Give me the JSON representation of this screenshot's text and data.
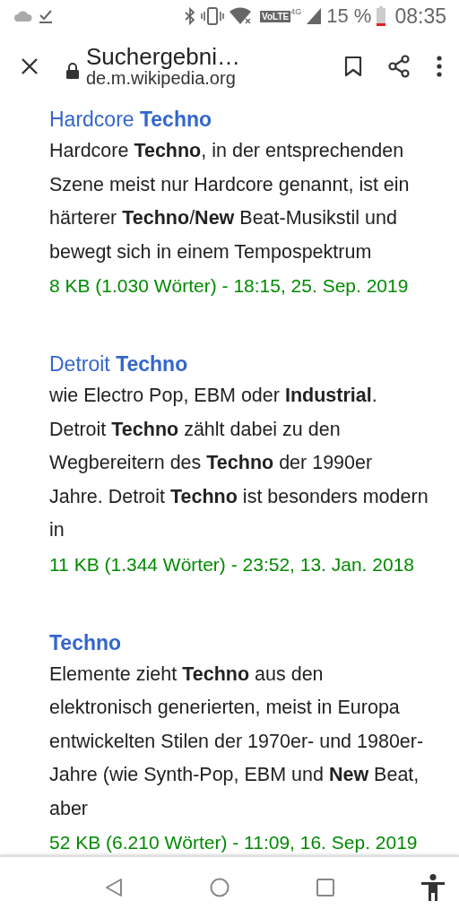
{
  "status_bar": {
    "volte": "VoLTE",
    "network": "4G",
    "battery": "15 %",
    "time": "08:35"
  },
  "toolbar": {
    "title": "Suchergebni…",
    "url": "de.m.wikipedia.org"
  },
  "results": [
    {
      "title": "Hardcore **Techno**",
      "snippet": "Hardcore **Techno**, in der entsprechenden Szene meist nur Hardcore genannt, ist ein härterer **Techno**/**New** Beat-Musikstil und bewegt sich in einem Tempospektrum",
      "meta": "8 KB (1.030 Wörter) - 18:15, 25. Sep. 2019"
    },
    {
      "title": "Detroit **Techno**",
      "snippet": "wie Electro Pop, EBM oder **Industrial**. Detroit **Techno** zählt dabei zu den Wegbereitern des **Techno** der 1990er Jahre. Detroit **Techno** ist besonders modern in",
      "meta": "11 KB (1.344 Wörter) - 23:52, 13. Jan. 2018"
    },
    {
      "title": "**Techno**",
      "snippet": "Elemente zieht **Techno** aus den elektronisch generierten, meist in Europa entwickelten Stilen der 1970er- und 1980er-Jahre (wie Synth-Pop, EBM und **New** Beat, aber",
      "meta": "52 KB (6.210 Wörter) - 11:09, 16. Sep. 2019"
    }
  ]
}
